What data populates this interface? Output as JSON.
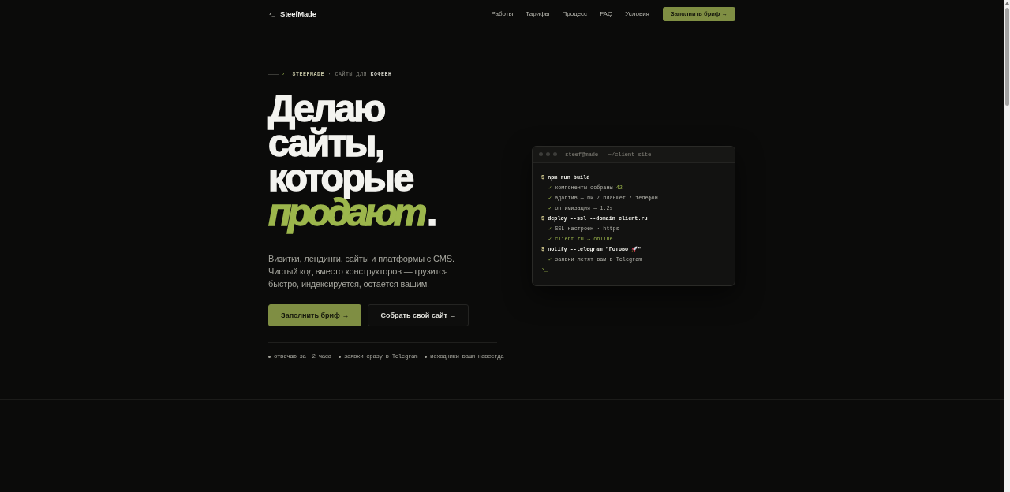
{
  "header": {
    "logo": {
      "prompt": "›_",
      "name": "SteefMade"
    },
    "nav": [
      "Работы",
      "Тарифы",
      "Процесс",
      "FAQ",
      "Условия"
    ],
    "cta": "Заполнить бриф →"
  },
  "hero": {
    "eyebrow": {
      "prompt": "›_",
      "brand": "STEEFMADE",
      "rest": "· САЙТЫ ДЛЯ",
      "accent": "КОФЕЕН"
    },
    "heading": {
      "lines": [
        "Делаю",
        "сайты,",
        "которые"
      ],
      "accent": "продают",
      "end": "."
    },
    "lead": "Визитки, лендинги, сайты и платформы с CMS. Чистый код вместо конструкторов — грузится быстро, индексируется, остаётся вашим.",
    "buttons": [
      {
        "label": "Заполнить бриф →",
        "kind": "primary"
      },
      {
        "label": "Собрать свой сайт →",
        "kind": "secondary"
      }
    ],
    "perks": [
      "отвечаю за ~2 часа",
      "заявки сразу в Telegram",
      "исходники ваши навсегда"
    ]
  },
  "terminal": {
    "title": "steef@made — ~/client-site",
    "lines": [
      {
        "kind": "command",
        "prompt": "$",
        "segments": [
          {
            "kind": "text",
            "text": "npm run build",
            "highlighted": false
          }
        ]
      },
      {
        "kind": "result",
        "mark": "✓",
        "segments": [
          {
            "kind": "text",
            "text": "компоненты собраны ",
            "highlighted": false
          },
          {
            "kind": "text",
            "text": "42",
            "highlighted": true
          }
        ]
      },
      {
        "kind": "result",
        "mark": "✓",
        "segments": [
          {
            "kind": "text",
            "text": "адаптив — пк / планшет / телефон",
            "highlighted": false
          }
        ]
      },
      {
        "kind": "result",
        "mark": "✓",
        "segments": [
          {
            "kind": "text",
            "text": "оптимизация — 1.2s",
            "highlighted": false
          }
        ]
      },
      {
        "kind": "command",
        "prompt": "$",
        "segments": [
          {
            "kind": "text",
            "text": "deploy --ssl --domain client.ru",
            "highlighted": false
          }
        ]
      },
      {
        "kind": "result",
        "mark": "✓",
        "segments": [
          {
            "kind": "text",
            "text": "SSL настроен · https",
            "highlighted": false
          }
        ]
      },
      {
        "kind": "result",
        "mark": "✓",
        "segments": [
          {
            "kind": "text",
            "text": "client.ru → online",
            "highlighted": true
          }
        ]
      },
      {
        "kind": "command",
        "prompt": "$",
        "segments": [
          {
            "kind": "text",
            "text": "notify --telegram \"Готово ",
            "highlighted": false
          },
          {
            "kind": "icon"
          },
          {
            "kind": "text",
            "text": "\"",
            "highlighted": false
          }
        ]
      },
      {
        "kind": "result",
        "mark": "✓",
        "segments": [
          {
            "kind": "text",
            "text": "заявки летят вам в Telegram",
            "highlighted": false
          }
        ]
      },
      {
        "kind": "cursor",
        "text": "›_"
      }
    ]
  }
}
